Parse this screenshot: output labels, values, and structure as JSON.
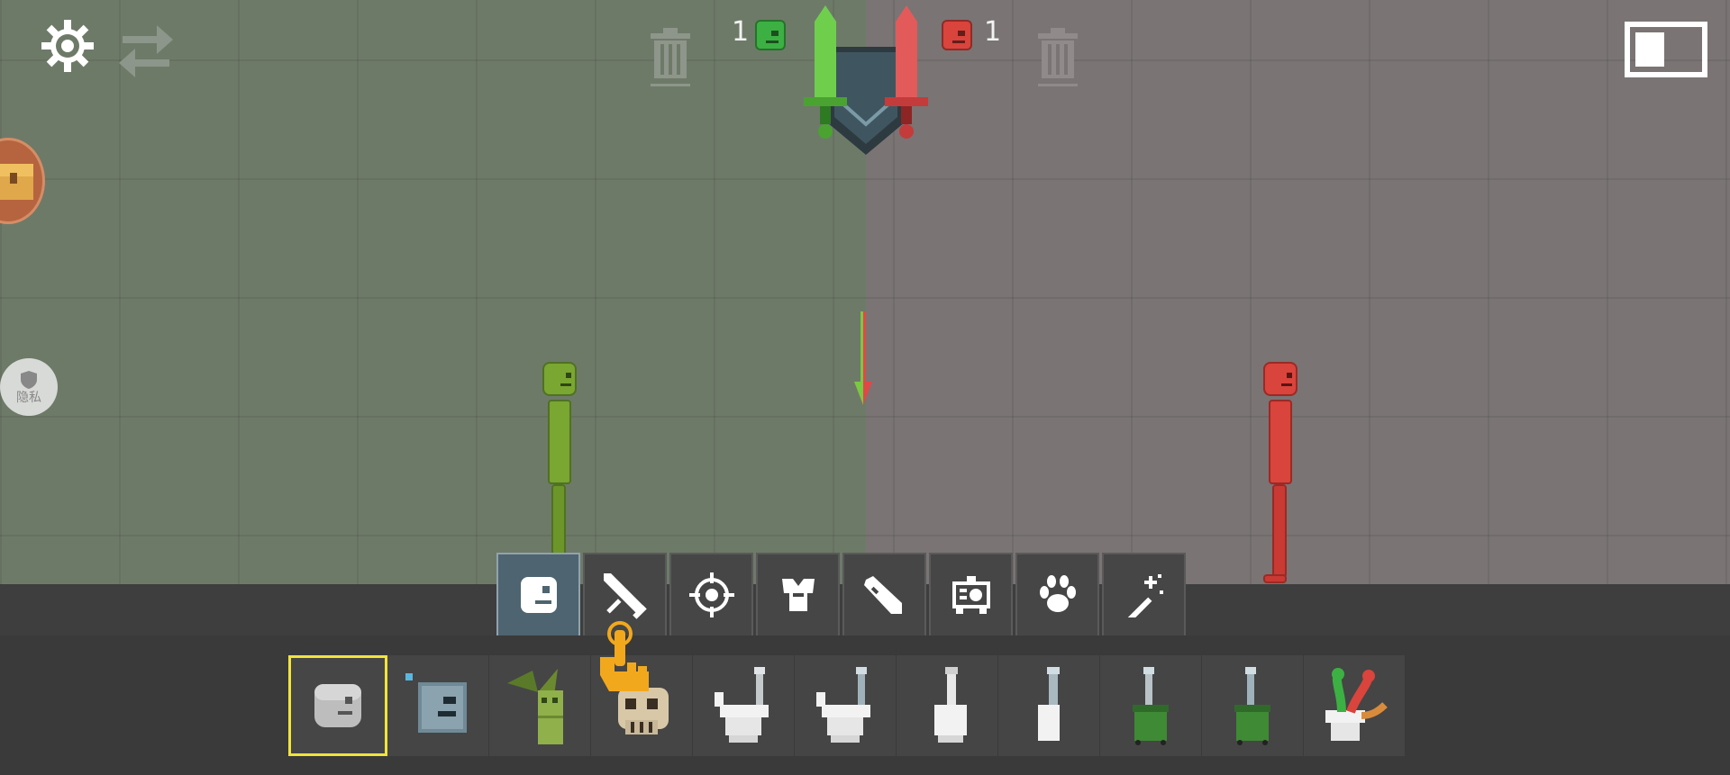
{
  "topbar": {
    "settings_icon": "gear-icon",
    "swap_icon": "swap-arrows-icon",
    "left_trash_icon": "trash-icon",
    "right_trash_icon": "trash-icon",
    "fullscreen_icon": "window-toggle-icon"
  },
  "score": {
    "green_count": "1",
    "red_count": "1",
    "green_color": "#3cb043",
    "red_color": "#d9443c",
    "emblem_icon": "crossed-swords-shield-icon"
  },
  "side": {
    "chest_icon": "treasure-chest-icon",
    "privacy_label": "隐私",
    "privacy_icon": "shield-icon"
  },
  "arena": {
    "left_color": "#6e7a68",
    "right_color": "#7a7474",
    "green_ragdoll": "green-ragdoll",
    "red_ragdoll": "red-ragdoll",
    "gravity_arrow_icon": "down-arrow-icon"
  },
  "categories": [
    {
      "name": "characters",
      "icon": "ragdoll-head-icon",
      "active": true
    },
    {
      "name": "melee",
      "icon": "sword-icon",
      "active": false
    },
    {
      "name": "firearms",
      "icon": "crosshair-icon",
      "active": false
    },
    {
      "name": "clothing",
      "icon": "armor-icon",
      "active": false
    },
    {
      "name": "explosives",
      "icon": "rocket-icon",
      "active": false
    },
    {
      "name": "machines",
      "icon": "machine-icon",
      "active": false
    },
    {
      "name": "animals",
      "icon": "paw-icon",
      "active": false
    },
    {
      "name": "magic",
      "icon": "magic-wand-icon",
      "active": false
    }
  ],
  "items": [
    {
      "name": "gray-head",
      "selected": true
    },
    {
      "name": "robot-head",
      "selected": false
    },
    {
      "name": "bamboo-figure",
      "selected": false
    },
    {
      "name": "skull",
      "selected": false
    },
    {
      "name": "toilet-1",
      "selected": false
    },
    {
      "name": "toilet-2",
      "selected": false
    },
    {
      "name": "toilet-3",
      "selected": false
    },
    {
      "name": "toilet-4",
      "selected": false
    },
    {
      "name": "green-bin-1",
      "selected": false
    },
    {
      "name": "green-bin-2",
      "selected": false
    },
    {
      "name": "worm-toilet",
      "selected": false
    }
  ],
  "tutorial": {
    "icon": "pointing-hand-icon"
  }
}
